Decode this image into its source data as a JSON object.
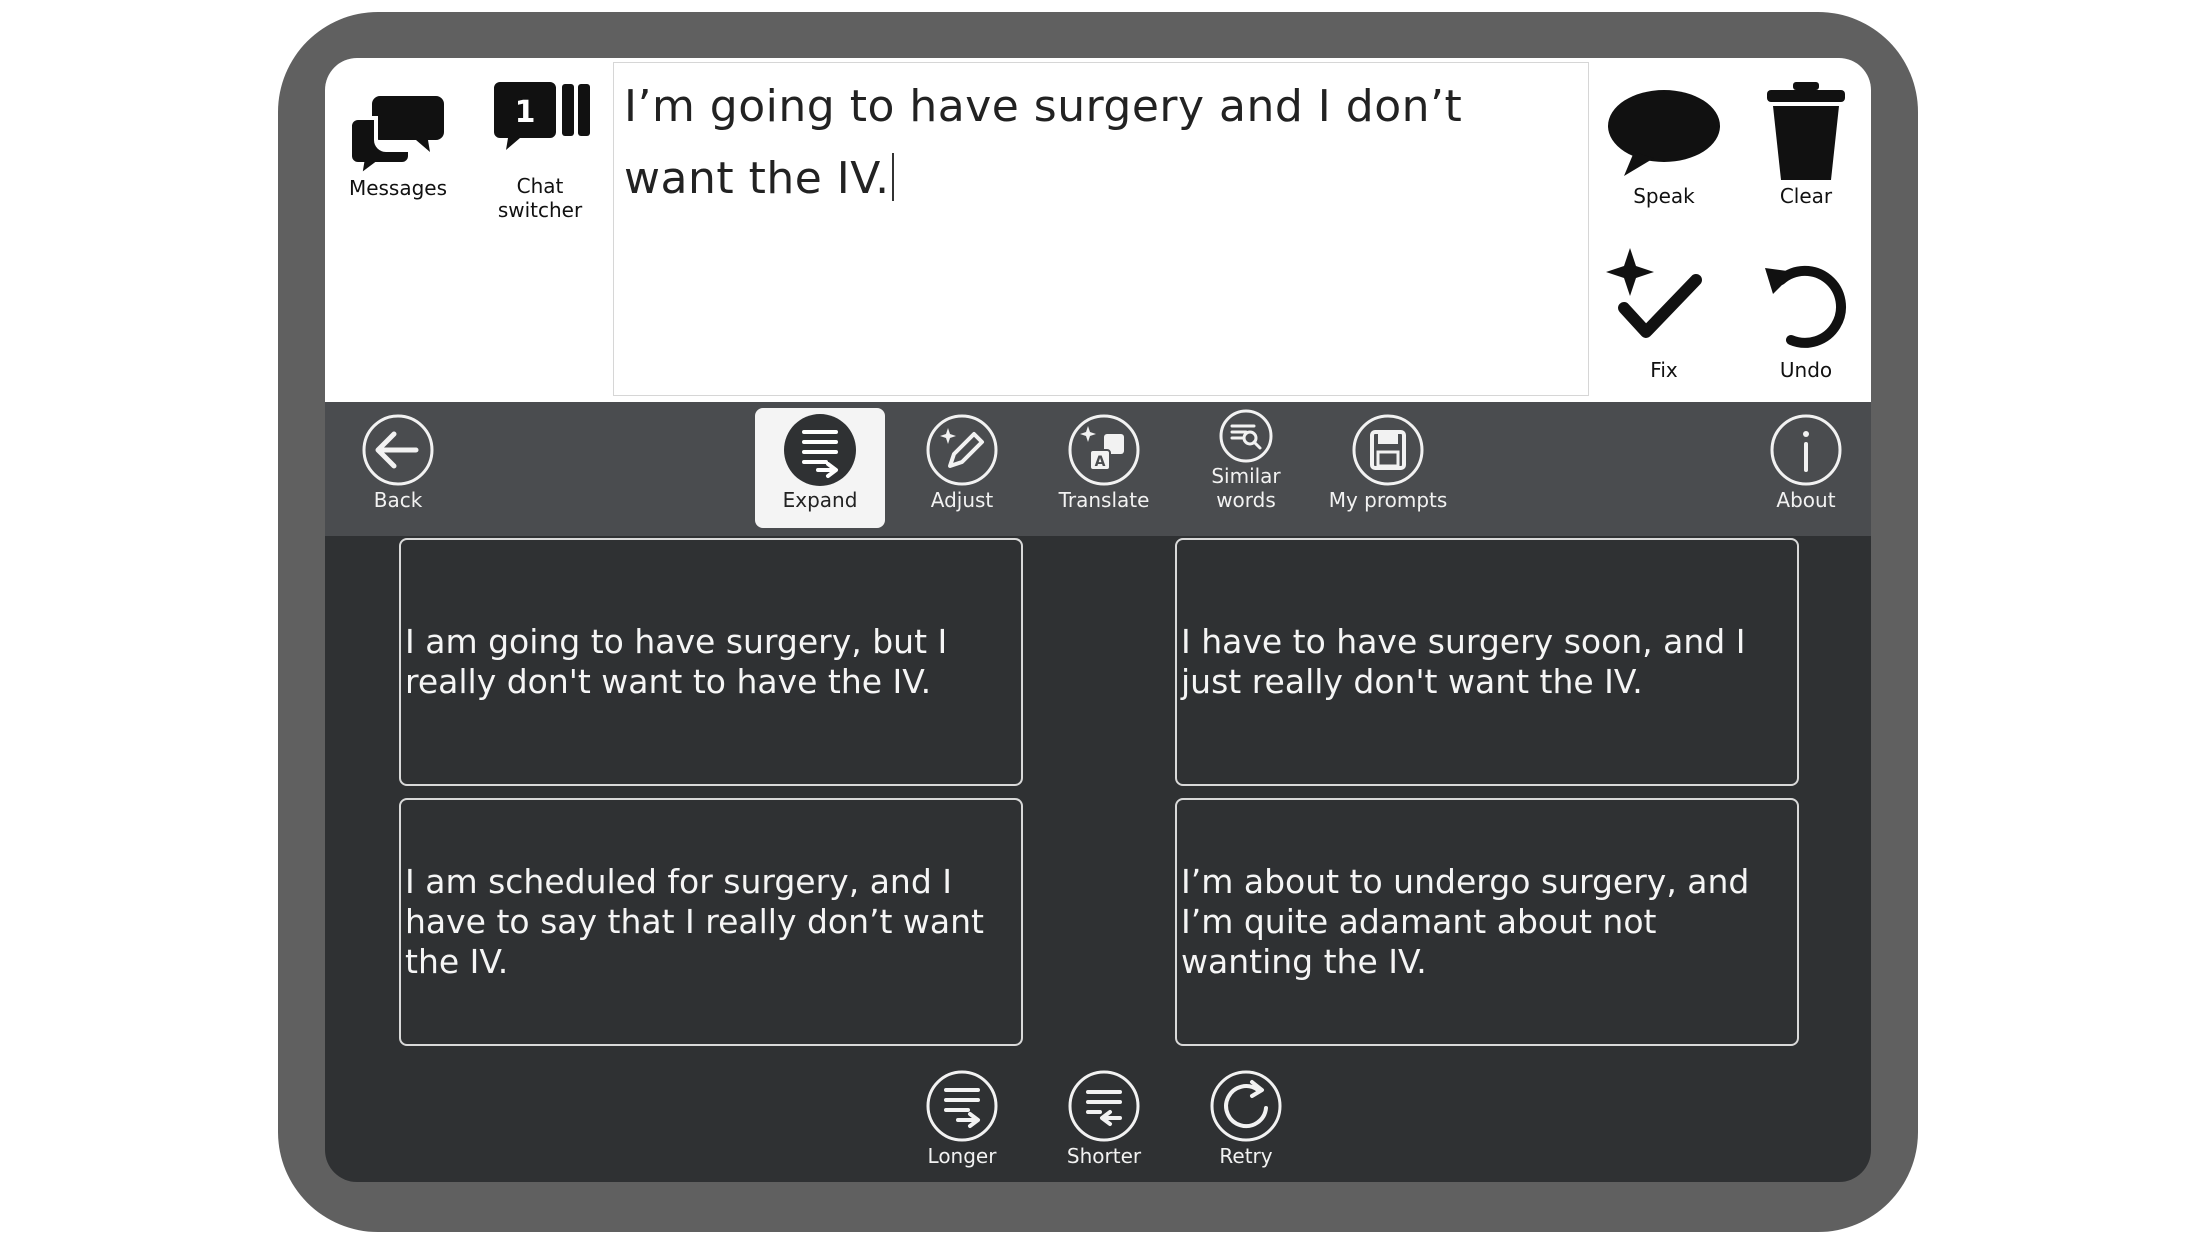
{
  "top_left": {
    "messages_label": "Messages",
    "chat_switcher_badge": "1",
    "chat_switcher_label_line1": "Chat",
    "chat_switcher_label_line2": "switcher"
  },
  "composer": {
    "text": "I’m going to have surgery and I don’t want the IV."
  },
  "top_right": {
    "speak_label": "Speak",
    "clear_label": "Clear",
    "fix_label": "Fix",
    "undo_label": "Undo"
  },
  "toolbar": {
    "back_label": "Back",
    "expand_label": "Expand",
    "adjust_label": "Adjust",
    "translate_label": "Translate",
    "similar_line1": "Similar",
    "similar_line2": "words",
    "my_prompts_label": "My prompts",
    "about_label": "About",
    "active_tab": "Expand"
  },
  "suggestions": [
    "I am going to have surgery, but I really don't want to have the IV.",
    "I have to have surgery soon, and I just really don't want the IV.",
    "I am scheduled for surgery, and I have to say that I really don’t want the IV.",
    "I’m about to undergo surgery, and I’m quite adamant about not wanting the IV."
  ],
  "bottom": {
    "longer_label": "Longer",
    "shorter_label": "Shorter",
    "retry_label": "Retry"
  }
}
